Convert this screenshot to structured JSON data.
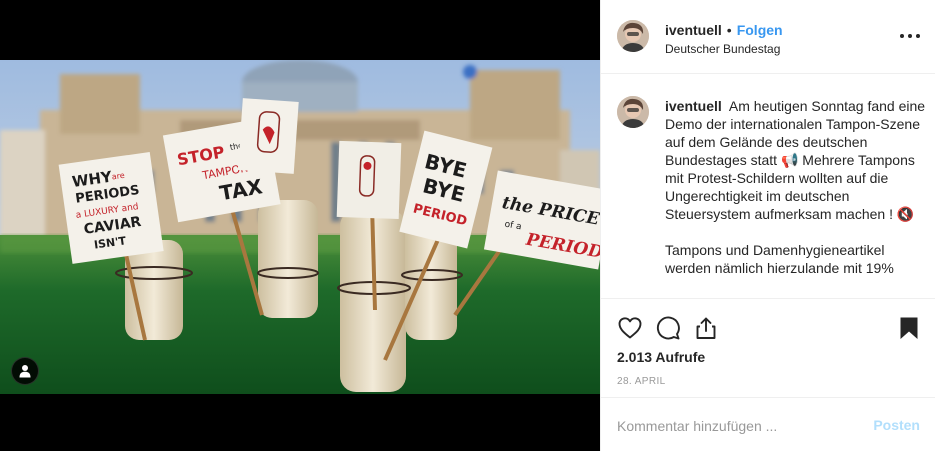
{
  "post": {
    "username": "iventuell",
    "separator": "•",
    "follow_label": "Folgen",
    "location": "Deutscher Bundestag",
    "more_icon": "more-options-icon"
  },
  "caption": {
    "username": "iventuell",
    "paragraph1": "Am heutigen Sonntag fand eine Demo der internationalen Tampon-Szene auf dem Gelände des deutschen Bundestages statt 📢 Mehrere Tampons mit Protest-Schildern wollten auf die Ungerechtigkeit im deutschen Steuersystem aufmerksam machen ! 🔇",
    "paragraph2": "Tampons und Damenhygieneartikel werden nämlich hierzulande mit 19%"
  },
  "media": {
    "signs": {
      "sign1": [
        "WHY",
        "are",
        "PERIODS",
        "a LUXURY and",
        "CAVIAR",
        "ISN'T"
      ],
      "sign2": [
        "STOP",
        "the",
        "TAMPON",
        "TAX"
      ],
      "sign3": [
        "BYE",
        "BYE",
        "PERIOD"
      ],
      "sign4": [
        "the PRICE",
        "of a",
        "PERIOD"
      ]
    },
    "user_tag_icon": "user-tag-icon"
  },
  "actions": {
    "icons": [
      "heart-icon",
      "comment-icon",
      "share-icon",
      "bookmark-icon"
    ],
    "views": "2.013 Aufrufe",
    "date": "28. April"
  },
  "comment_box": {
    "placeholder": "Kommentar hinzufügen ...",
    "post_label": "Posten"
  },
  "colors": {
    "accent": "#3897f0",
    "post_disabled": "#b2dffc",
    "grass": "#1f6b2a",
    "sky": "#a9c3df"
  }
}
